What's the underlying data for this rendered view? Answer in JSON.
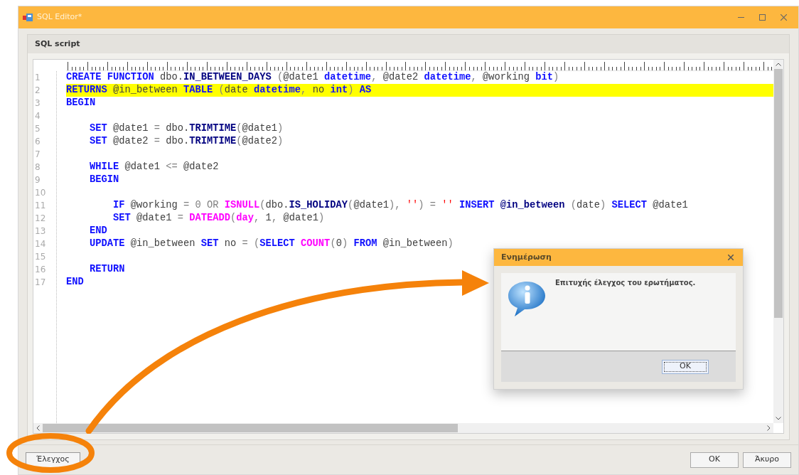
{
  "window": {
    "title": "SQL Editor*"
  },
  "panel": {
    "title": "SQL script"
  },
  "editor": {
    "lines": [
      {
        "number": "1",
        "highlighted": false,
        "tokens": [
          {
            "kind": "k",
            "text": "CREATE FUNCTION"
          },
          {
            "kind": "p",
            "text": " dbo."
          },
          {
            "kind": "o",
            "text": "IN_BETWEEN_DAYS"
          },
          {
            "kind": "g",
            "text": " ("
          },
          {
            "kind": "p",
            "text": "@date1 "
          },
          {
            "kind": "k",
            "text": "datetime"
          },
          {
            "kind": "g",
            "text": ", "
          },
          {
            "kind": "p",
            "text": "@date2 "
          },
          {
            "kind": "k",
            "text": "datetime"
          },
          {
            "kind": "g",
            "text": ", "
          },
          {
            "kind": "p",
            "text": "@working "
          },
          {
            "kind": "k",
            "text": "bit"
          },
          {
            "kind": "g",
            "text": ")"
          }
        ]
      },
      {
        "number": "2",
        "highlighted": true,
        "tokens": [
          {
            "kind": "k",
            "text": "RETURNS"
          },
          {
            "kind": "p",
            "text": " @in_between "
          },
          {
            "kind": "k",
            "text": "TABLE"
          },
          {
            "kind": "g",
            "text": " ("
          },
          {
            "kind": "p",
            "text": "date "
          },
          {
            "kind": "k",
            "text": "datetime"
          },
          {
            "kind": "g",
            "text": ", "
          },
          {
            "kind": "p",
            "text": "no "
          },
          {
            "kind": "k",
            "text": "int"
          },
          {
            "kind": "g",
            "text": ")"
          },
          {
            "kind": "k",
            "text": " AS"
          }
        ]
      },
      {
        "number": "3",
        "highlighted": false,
        "tokens": [
          {
            "kind": "k",
            "text": "BEGIN"
          }
        ]
      },
      {
        "number": "4",
        "highlighted": false
      },
      {
        "number": "5",
        "highlighted": false,
        "tokens": [
          {
            "kind": "k",
            "text": "    SET"
          },
          {
            "kind": "p",
            "text": " @date1 "
          },
          {
            "kind": "g",
            "text": "="
          },
          {
            "kind": "p",
            "text": " dbo."
          },
          {
            "kind": "o",
            "text": "TRIMTIME"
          },
          {
            "kind": "g",
            "text": "("
          },
          {
            "kind": "p",
            "text": "@date1"
          },
          {
            "kind": "g",
            "text": ")"
          }
        ]
      },
      {
        "number": "6",
        "highlighted": false,
        "tokens": [
          {
            "kind": "k",
            "text": "    SET"
          },
          {
            "kind": "p",
            "text": " @date2 "
          },
          {
            "kind": "g",
            "text": "="
          },
          {
            "kind": "p",
            "text": " dbo."
          },
          {
            "kind": "o",
            "text": "TRIMTIME"
          },
          {
            "kind": "g",
            "text": "("
          },
          {
            "kind": "p",
            "text": "@date2"
          },
          {
            "kind": "g",
            "text": ")"
          }
        ]
      },
      {
        "number": "7",
        "highlighted": false
      },
      {
        "number": "8",
        "highlighted": false,
        "tokens": [
          {
            "kind": "k",
            "text": "    WHILE"
          },
          {
            "kind": "p",
            "text": " @date1 "
          },
          {
            "kind": "g",
            "text": "<="
          },
          {
            "kind": "p",
            "text": " @date2"
          }
        ]
      },
      {
        "number": "9",
        "highlighted": false,
        "tokens": [
          {
            "kind": "k",
            "text": "    BEGIN"
          }
        ]
      },
      {
        "number": "10",
        "highlighted": false
      },
      {
        "number": "11",
        "highlighted": false,
        "tokens": [
          {
            "kind": "k",
            "text": "        IF"
          },
          {
            "kind": "p",
            "text": " @working "
          },
          {
            "kind": "g",
            "text": "= 0 OR "
          },
          {
            "kind": "f",
            "text": "ISNULL"
          },
          {
            "kind": "g",
            "text": "("
          },
          {
            "kind": "p",
            "text": "dbo."
          },
          {
            "kind": "o",
            "text": "IS_HOLIDAY"
          },
          {
            "kind": "g",
            "text": "("
          },
          {
            "kind": "p",
            "text": "@date1"
          },
          {
            "kind": "g",
            "text": "), "
          },
          {
            "kind": "s",
            "text": "''"
          },
          {
            "kind": "g",
            "text": ") = "
          },
          {
            "kind": "s",
            "text": "''"
          },
          {
            "kind": "k",
            "text": " INSERT"
          },
          {
            "kind": "o",
            "text": " @in_between"
          },
          {
            "kind": "g",
            "text": " ("
          },
          {
            "kind": "p",
            "text": "date"
          },
          {
            "kind": "g",
            "text": ")"
          },
          {
            "kind": "k",
            "text": " SELECT"
          },
          {
            "kind": "p",
            "text": " @date1"
          }
        ]
      },
      {
        "number": "12",
        "highlighted": false,
        "tokens": [
          {
            "kind": "k",
            "text": "        SET"
          },
          {
            "kind": "p",
            "text": " @date1 "
          },
          {
            "kind": "g",
            "text": "= "
          },
          {
            "kind": "f",
            "text": "DATEADD"
          },
          {
            "kind": "g",
            "text": "("
          },
          {
            "kind": "f",
            "text": "day"
          },
          {
            "kind": "g",
            "text": ", "
          },
          {
            "kind": "p",
            "text": "1"
          },
          {
            "kind": "g",
            "text": ", "
          },
          {
            "kind": "p",
            "text": "@date1"
          },
          {
            "kind": "g",
            "text": ")"
          }
        ]
      },
      {
        "number": "13",
        "highlighted": false,
        "tokens": [
          {
            "kind": "k",
            "text": "    END"
          }
        ]
      },
      {
        "number": "14",
        "highlighted": false,
        "tokens": [
          {
            "kind": "k",
            "text": "    UPDATE"
          },
          {
            "kind": "p",
            "text": " @in_between "
          },
          {
            "kind": "k",
            "text": "SET"
          },
          {
            "kind": "p",
            "text": " no "
          },
          {
            "kind": "g",
            "text": "= ("
          },
          {
            "kind": "k",
            "text": "SELECT"
          },
          {
            "kind": "f",
            "text": " COUNT"
          },
          {
            "kind": "g",
            "text": "("
          },
          {
            "kind": "p",
            "text": "0"
          },
          {
            "kind": "g",
            "text": ")"
          },
          {
            "kind": "k",
            "text": " FROM"
          },
          {
            "kind": "p",
            "text": " @in_between"
          },
          {
            "kind": "g",
            "text": ")"
          }
        ]
      },
      {
        "number": "15",
        "highlighted": false
      },
      {
        "number": "16",
        "highlighted": false,
        "tokens": [
          {
            "kind": "k",
            "text": "    RETURN"
          }
        ]
      },
      {
        "number": "17",
        "highlighted": false,
        "tokens": [
          {
            "kind": "k",
            "text": "END"
          }
        ]
      }
    ]
  },
  "dialog": {
    "title": "Ενημέρωση",
    "message": "Επιτυχής έλεγχος του ερωτήματος.",
    "button": "OK"
  },
  "footer": {
    "left_button": "Έλεγχος",
    "buttons": [
      "OK",
      "Άκυρο"
    ]
  }
}
